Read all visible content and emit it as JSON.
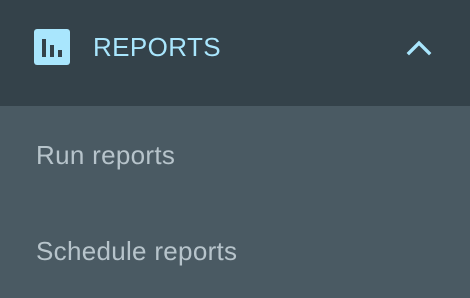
{
  "reports_menu": {
    "title": "REPORTS",
    "icon": "bar-chart-icon",
    "toggle_icon": "chevron-up-icon",
    "expanded": true,
    "items": [
      {
        "label": "Run reports"
      },
      {
        "label": "Schedule reports"
      }
    ]
  },
  "colors": {
    "header_bg": "#34424a",
    "submenu_bg": "#4a5a63",
    "accent": "#a9e6fd",
    "item_text": "#b7c4cb"
  }
}
